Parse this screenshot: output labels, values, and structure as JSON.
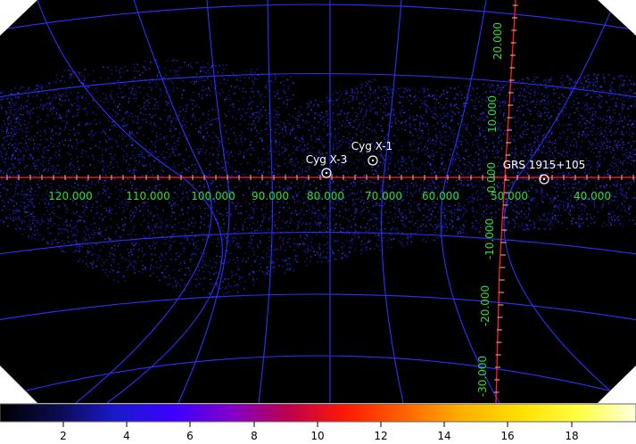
{
  "sky_map": {
    "sources": [
      {
        "name": "Cyg X-1",
        "l": 71.3,
        "b": 3.1
      },
      {
        "name": "Cyg X-3",
        "l": 79.8,
        "b": 0.7
      },
      {
        "name": "GRS 1915+105",
        "l": 45.4,
        "b": -0.2
      }
    ],
    "longitude_ticks": [
      "120.000",
      "110.000",
      "100.000",
      "90.000",
      "80.000",
      "70.000",
      "60.000",
      "50.000",
      "40.000"
    ],
    "latitude_ticks": [
      "20.000",
      "10.000",
      "0.000",
      "-10.000",
      "-20.000",
      "-30.000"
    ],
    "colors": {
      "background": "#000000",
      "grid": "#2f2fff",
      "axes": "#ff2020",
      "tick_labels": "#33dd33",
      "source_markers": "#ffffff",
      "outside": "#ffffff"
    }
  },
  "colorbar": {
    "ticks": [
      "2",
      "4",
      "6",
      "8",
      "10",
      "12",
      "14",
      "16",
      "18"
    ],
    "colormap": [
      "#000000",
      "#0b0b50",
      "#1a1acc",
      "#3c00ff",
      "#8000c8",
      "#c0004a",
      "#ff1a00",
      "#ff6400",
      "#ffb000",
      "#ffe000",
      "#ffff40",
      "#ffffe0"
    ]
  }
}
